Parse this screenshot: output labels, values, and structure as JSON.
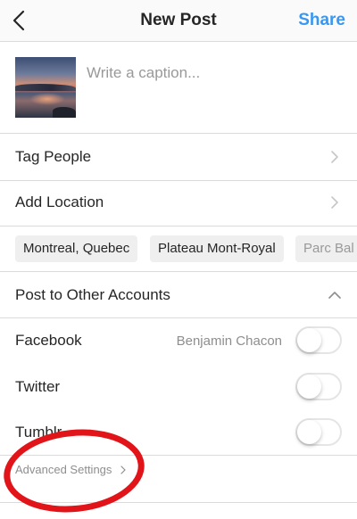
{
  "header": {
    "title": "New Post",
    "share_label": "Share"
  },
  "caption": {
    "placeholder": "Write a caption..."
  },
  "options": {
    "tag_people": "Tag People",
    "add_location": "Add Location"
  },
  "location_suggestions": [
    "Montreal, Quebec",
    "Plateau Mont-Royal",
    "Parc Bal"
  ],
  "other_accounts": {
    "heading": "Post to Other Accounts",
    "facebook_label": "Facebook",
    "facebook_account": "Benjamin Chacon",
    "twitter_label": "Twitter",
    "tumblr_label": "Tumblr"
  },
  "advanced_settings": "Advanced Settings",
  "toggles": {
    "facebook": false,
    "twitter": false,
    "tumblr": false
  },
  "colors": {
    "accent": "#3897f0",
    "annotation": "#e1141a"
  }
}
